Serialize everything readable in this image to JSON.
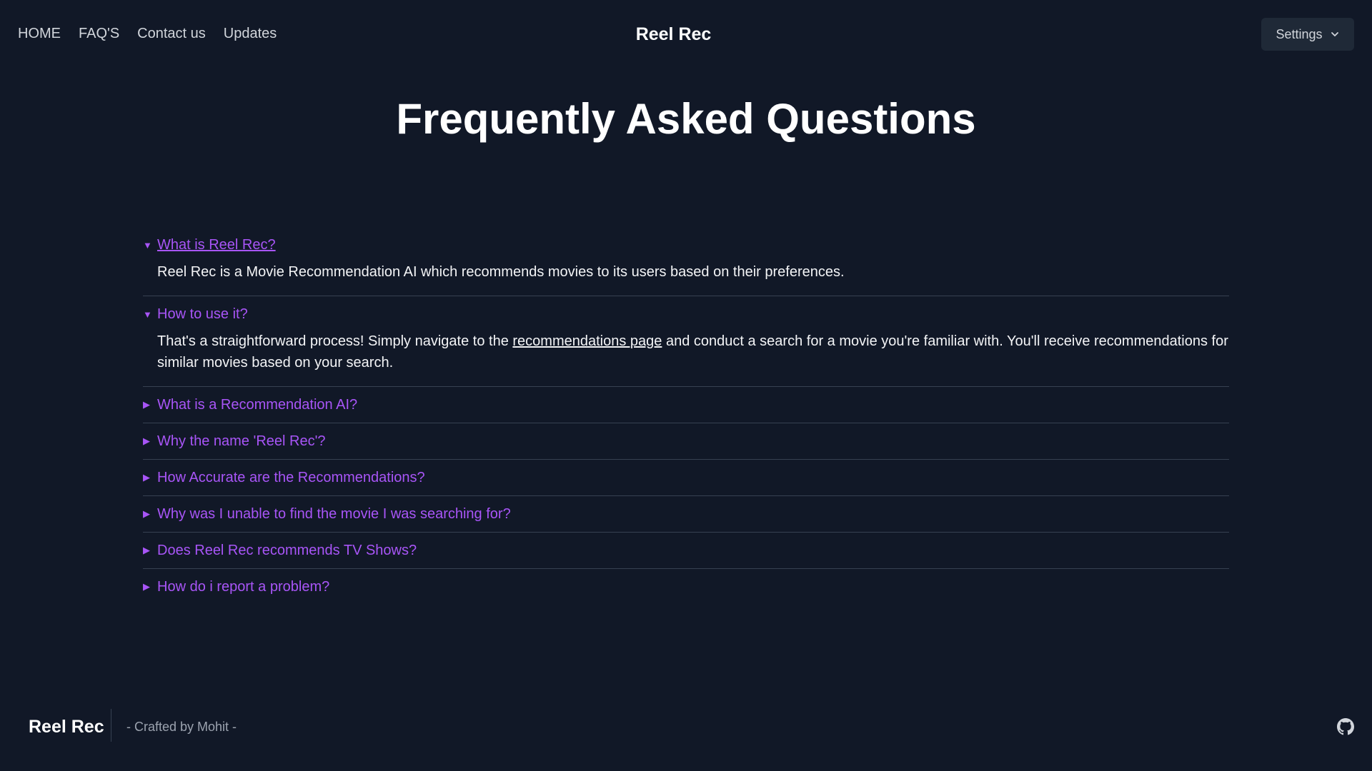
{
  "nav": {
    "items": [
      {
        "label": "HOME"
      },
      {
        "label": "FAQ'S"
      },
      {
        "label": "Contact us"
      },
      {
        "label": "Updates"
      }
    ],
    "brand": "Reel Rec",
    "settings_label": "Settings"
  },
  "main": {
    "title": "Frequently Asked Questions",
    "faqs": [
      {
        "question": "What is Reel Rec?",
        "expanded": true,
        "answer": "Reel Rec is a Movie Recommendation AI which recommends movies to its users based on their preferences."
      },
      {
        "question": "How to use it?",
        "expanded": true,
        "answer_before": "That's a straightforward process! Simply navigate to the ",
        "answer_link": "recommendations page",
        "answer_after": " and conduct a search for a movie you're familiar with. You'll receive recommendations for similar movies based on your search."
      },
      {
        "question": "What is a Recommendation AI?",
        "expanded": false
      },
      {
        "question": "Why the name 'Reel Rec'?",
        "expanded": false
      },
      {
        "question": "How Accurate are the Recommendations?",
        "expanded": false
      },
      {
        "question": "Why was I unable to find the movie I was searching for?",
        "expanded": false
      },
      {
        "question": "Does Reel Rec recommends TV Shows?",
        "expanded": false
      },
      {
        "question": "How do i report a problem?",
        "expanded": false
      }
    ]
  },
  "footer": {
    "brand": "Reel Rec",
    "credit": "- Crafted by Mohit -"
  },
  "colors": {
    "background": "#111827",
    "accent": "#a855f7",
    "divider": "#374151",
    "button_bg": "#1f2937"
  },
  "icons": {
    "settings_chevron": "chevron-down-icon",
    "expanded_marker": "triangle-down-icon",
    "collapsed_marker": "triangle-right-icon",
    "footer_link": "github-icon"
  }
}
